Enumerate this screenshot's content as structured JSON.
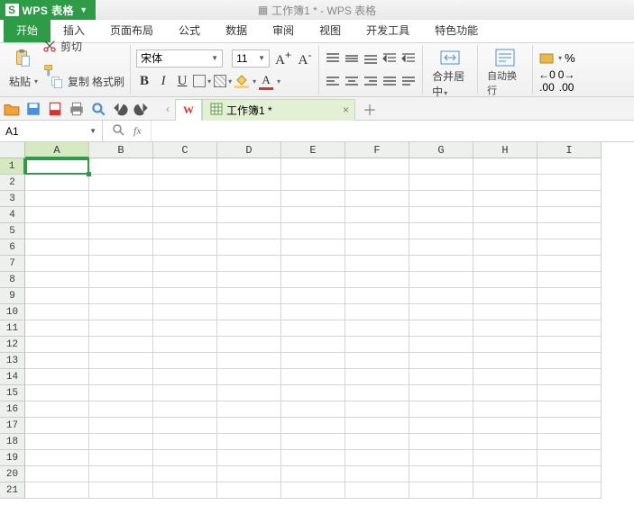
{
  "app": {
    "name": "WPS 表格",
    "doc_title": "工作簿1 * - WPS 表格"
  },
  "menu": {
    "tabs": [
      "开始",
      "插入",
      "页面布局",
      "公式",
      "数据",
      "审阅",
      "视图",
      "开发工具",
      "特色功能"
    ],
    "active": 0
  },
  "ribbon": {
    "clipboard": {
      "paste": "粘贴",
      "cut": "剪切",
      "copy": "复制",
      "format_painter": "格式刷"
    },
    "font": {
      "name": "宋体",
      "size": "11"
    },
    "merge": "合并居中",
    "wrap": "自动换行",
    "num_fmt_inc": ".00",
    "num_fmt_dec": ".00"
  },
  "qat": {
    "doc_tab_wps": "W",
    "doc_tab_active": "工作簿1 *"
  },
  "fx": {
    "namebox": "A1",
    "fx_label": "fx"
  },
  "grid": {
    "cols": [
      "A",
      "B",
      "C",
      "D",
      "E",
      "F",
      "G",
      "H",
      "I"
    ],
    "rows": [
      "1",
      "2",
      "3",
      "4",
      "5",
      "6",
      "7",
      "8",
      "9",
      "10",
      "11",
      "12",
      "13",
      "14",
      "15",
      "16",
      "17",
      "18",
      "19",
      "20",
      "21"
    ],
    "active_cell": "A1"
  }
}
